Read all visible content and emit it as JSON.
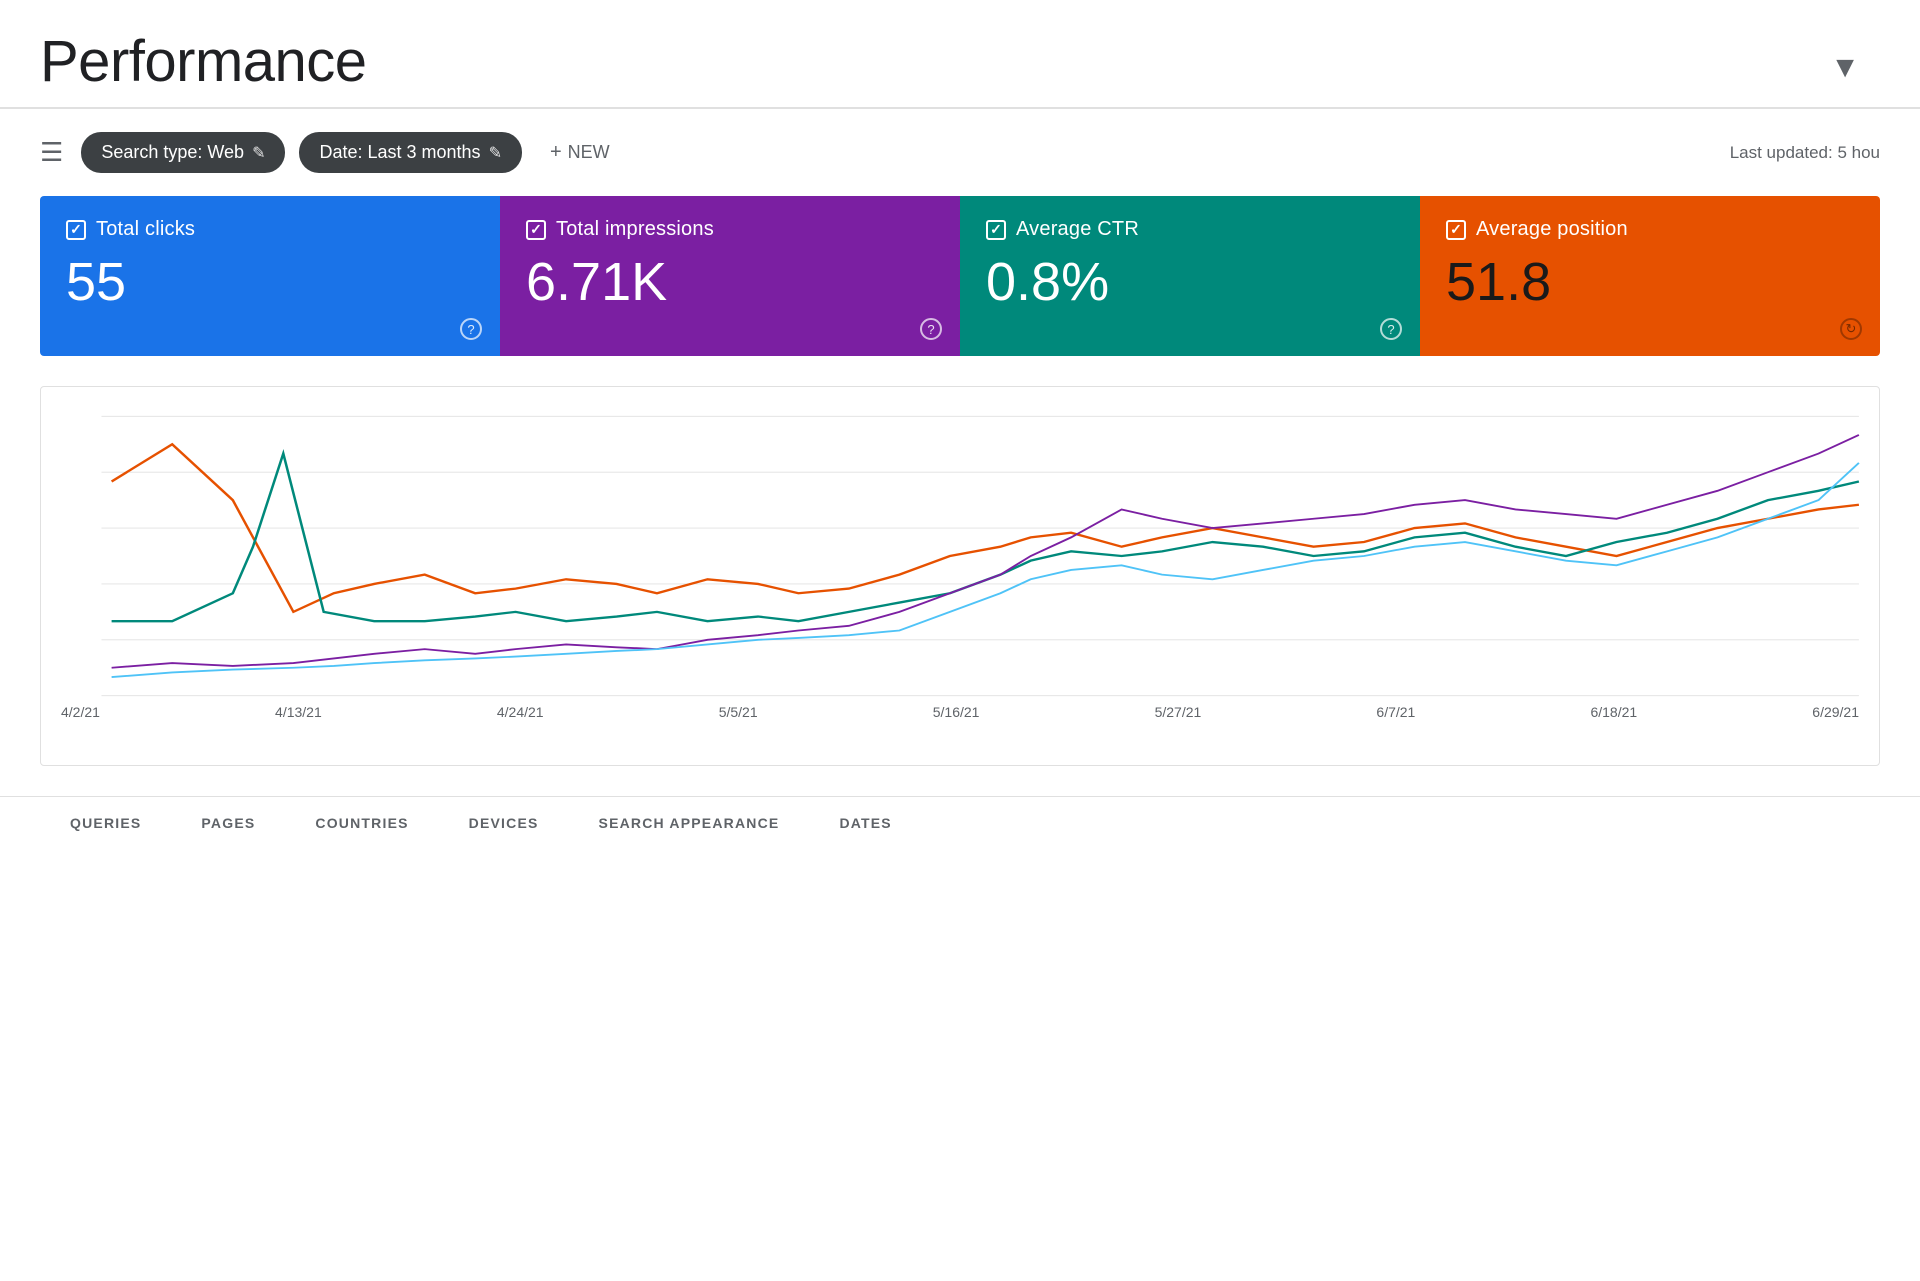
{
  "header": {
    "title": "Performance",
    "last_updated": "Last updated: 5 hou"
  },
  "toolbar": {
    "filter_icon_label": "≡",
    "search_type_btn": "Search type: Web",
    "date_btn": "Date: Last 3 months",
    "new_btn": "NEW",
    "edit_icon": "✎"
  },
  "metrics": [
    {
      "id": "clicks",
      "label": "Total clicks",
      "value": "55",
      "color": "#1a73e8"
    },
    {
      "id": "impressions",
      "label": "Total impressions",
      "value": "6.71K",
      "color": "#7b1fa2"
    },
    {
      "id": "ctr",
      "label": "Average CTR",
      "value": "0.8%",
      "color": "#00897b"
    },
    {
      "id": "position",
      "label": "Average position",
      "value": "51.8",
      "color": "#e65100"
    }
  ],
  "chart": {
    "x_labels": [
      "4/2/21",
      "4/13/21",
      "4/24/21",
      "5/5/21",
      "5/16/21",
      "5/27/21",
      "6/7/21",
      "6/18/21",
      "6/29/21"
    ],
    "series": {
      "clicks": "#1a73e8",
      "impressions": "#9c27b0",
      "ctr": "#00897b",
      "position": "#e65100"
    }
  },
  "bottom_tabs": [
    {
      "label": "QUERIES"
    },
    {
      "label": "PAGES"
    },
    {
      "label": "COUNTRIES"
    },
    {
      "label": "DEVICES"
    },
    {
      "label": "SEARCH APPEARANCE"
    },
    {
      "label": "DATES"
    }
  ]
}
